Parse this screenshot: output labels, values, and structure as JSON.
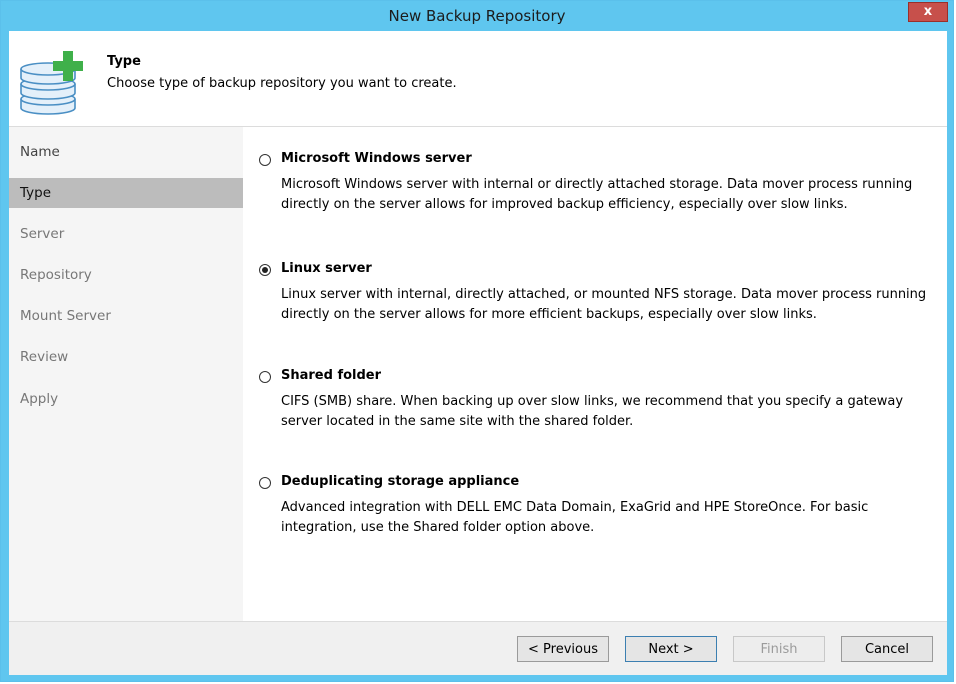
{
  "window": {
    "title": "New Backup Repository",
    "close_label": "x"
  },
  "header": {
    "title": "Type",
    "description": "Choose type of backup repository you want to create."
  },
  "sidebar": {
    "items": [
      {
        "label": "Name"
      },
      {
        "label": "Type"
      },
      {
        "label": "Server"
      },
      {
        "label": "Repository"
      },
      {
        "label": "Mount Server"
      },
      {
        "label": "Review"
      },
      {
        "label": "Apply"
      }
    ],
    "active_index": 1
  },
  "options": [
    {
      "label": "Microsoft Windows server",
      "description": "Microsoft Windows server with internal or directly attached storage. Data mover process running directly on the server allows for improved backup efficiency, especially over slow links.",
      "selected": false
    },
    {
      "label": "Linux server",
      "description": "Linux server with internal, directly attached, or mounted NFS storage. Data mover process running directly on the server allows for more efficient backups, especially over slow links.",
      "selected": true
    },
    {
      "label": "Shared folder",
      "description": "CIFS (SMB) share. When backing up over slow links, we recommend that you specify a gateway server located in the same site with the shared folder.",
      "selected": false
    },
    {
      "label": "Deduplicating storage appliance",
      "description": "Advanced integration with DELL EMC Data Domain, ExaGrid and HPE StoreOnce. For basic integration, use the Shared folder option above.",
      "selected": false
    }
  ],
  "footer": {
    "previous_label": "< Previous",
    "next_label": "Next >",
    "finish_label": "Finish",
    "cancel_label": "Cancel"
  },
  "icons": {
    "header": "database-add-icon",
    "close": "close-icon"
  },
  "colors": {
    "title_bar": "#5fc6ef",
    "close_button": "#c7504b",
    "active_nav": "#bcbcbc",
    "plus_icon": "#3fb04a"
  }
}
